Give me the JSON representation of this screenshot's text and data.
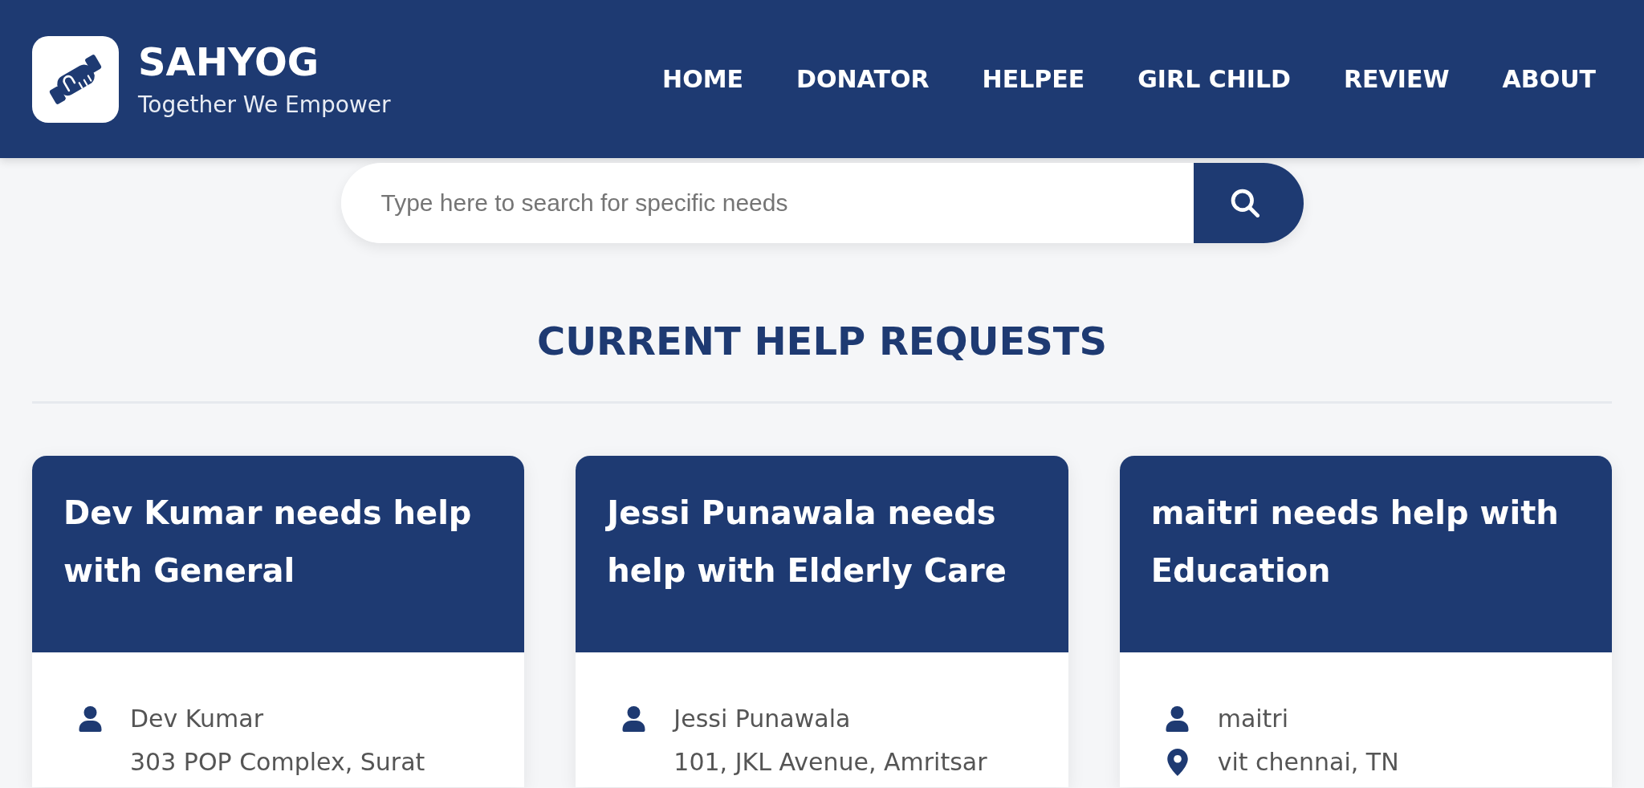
{
  "header": {
    "brand": {
      "name": "SAHYOG",
      "tagline": "Together We Empower"
    },
    "nav": [
      {
        "label": "HOME"
      },
      {
        "label": "DONATOR"
      },
      {
        "label": "HELPEE"
      },
      {
        "label": "GIRL CHILD"
      },
      {
        "label": "REVIEW"
      },
      {
        "label": "ABOUT"
      }
    ]
  },
  "search": {
    "placeholder": "Type here to search for specific needs"
  },
  "section": {
    "title": "CURRENT HELP REQUESTS"
  },
  "requests": [
    {
      "title": "Dev Kumar needs help with General",
      "details": [
        {
          "kind": "person",
          "text": "Dev Kumar"
        },
        {
          "kind": "plain",
          "text": "303 POP Complex, Surat"
        }
      ]
    },
    {
      "title": "Jessi Punawala needs help with Elderly Care",
      "details": [
        {
          "kind": "person",
          "text": "Jessi Punawala"
        },
        {
          "kind": "plain",
          "text": "101, JKL Avenue, Amritsar"
        }
      ]
    },
    {
      "title": "maitri needs help with Education",
      "details": [
        {
          "kind": "person",
          "text": "maitri"
        },
        {
          "kind": "location",
          "text": "vit chennai, TN"
        }
      ]
    }
  ]
}
